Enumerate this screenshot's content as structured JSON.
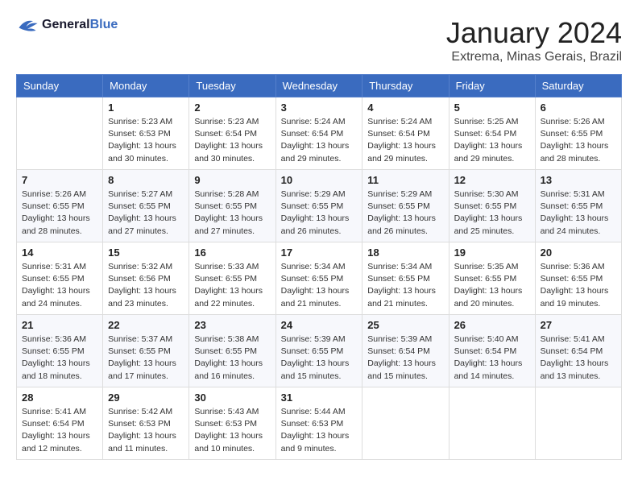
{
  "header": {
    "logo_line1": "General",
    "logo_line2": "Blue",
    "month_title": "January 2024",
    "location": "Extrema, Minas Gerais, Brazil"
  },
  "days_of_week": [
    "Sunday",
    "Monday",
    "Tuesday",
    "Wednesday",
    "Thursday",
    "Friday",
    "Saturday"
  ],
  "weeks": [
    [
      {
        "day": "",
        "info": ""
      },
      {
        "day": "1",
        "info": "Sunrise: 5:23 AM\nSunset: 6:53 PM\nDaylight: 13 hours\nand 30 minutes."
      },
      {
        "day": "2",
        "info": "Sunrise: 5:23 AM\nSunset: 6:54 PM\nDaylight: 13 hours\nand 30 minutes."
      },
      {
        "day": "3",
        "info": "Sunrise: 5:24 AM\nSunset: 6:54 PM\nDaylight: 13 hours\nand 29 minutes."
      },
      {
        "day": "4",
        "info": "Sunrise: 5:24 AM\nSunset: 6:54 PM\nDaylight: 13 hours\nand 29 minutes."
      },
      {
        "day": "5",
        "info": "Sunrise: 5:25 AM\nSunset: 6:54 PM\nDaylight: 13 hours\nand 29 minutes."
      },
      {
        "day": "6",
        "info": "Sunrise: 5:26 AM\nSunset: 6:55 PM\nDaylight: 13 hours\nand 28 minutes."
      }
    ],
    [
      {
        "day": "7",
        "info": "Sunrise: 5:26 AM\nSunset: 6:55 PM\nDaylight: 13 hours\nand 28 minutes."
      },
      {
        "day": "8",
        "info": "Sunrise: 5:27 AM\nSunset: 6:55 PM\nDaylight: 13 hours\nand 27 minutes."
      },
      {
        "day": "9",
        "info": "Sunrise: 5:28 AM\nSunset: 6:55 PM\nDaylight: 13 hours\nand 27 minutes."
      },
      {
        "day": "10",
        "info": "Sunrise: 5:29 AM\nSunset: 6:55 PM\nDaylight: 13 hours\nand 26 minutes."
      },
      {
        "day": "11",
        "info": "Sunrise: 5:29 AM\nSunset: 6:55 PM\nDaylight: 13 hours\nand 26 minutes."
      },
      {
        "day": "12",
        "info": "Sunrise: 5:30 AM\nSunset: 6:55 PM\nDaylight: 13 hours\nand 25 minutes."
      },
      {
        "day": "13",
        "info": "Sunrise: 5:31 AM\nSunset: 6:55 PM\nDaylight: 13 hours\nand 24 minutes."
      }
    ],
    [
      {
        "day": "14",
        "info": "Sunrise: 5:31 AM\nSunset: 6:55 PM\nDaylight: 13 hours\nand 24 minutes."
      },
      {
        "day": "15",
        "info": "Sunrise: 5:32 AM\nSunset: 6:56 PM\nDaylight: 13 hours\nand 23 minutes."
      },
      {
        "day": "16",
        "info": "Sunrise: 5:33 AM\nSunset: 6:55 PM\nDaylight: 13 hours\nand 22 minutes."
      },
      {
        "day": "17",
        "info": "Sunrise: 5:34 AM\nSunset: 6:55 PM\nDaylight: 13 hours\nand 21 minutes."
      },
      {
        "day": "18",
        "info": "Sunrise: 5:34 AM\nSunset: 6:55 PM\nDaylight: 13 hours\nand 21 minutes."
      },
      {
        "day": "19",
        "info": "Sunrise: 5:35 AM\nSunset: 6:55 PM\nDaylight: 13 hours\nand 20 minutes."
      },
      {
        "day": "20",
        "info": "Sunrise: 5:36 AM\nSunset: 6:55 PM\nDaylight: 13 hours\nand 19 minutes."
      }
    ],
    [
      {
        "day": "21",
        "info": "Sunrise: 5:36 AM\nSunset: 6:55 PM\nDaylight: 13 hours\nand 18 minutes."
      },
      {
        "day": "22",
        "info": "Sunrise: 5:37 AM\nSunset: 6:55 PM\nDaylight: 13 hours\nand 17 minutes."
      },
      {
        "day": "23",
        "info": "Sunrise: 5:38 AM\nSunset: 6:55 PM\nDaylight: 13 hours\nand 16 minutes."
      },
      {
        "day": "24",
        "info": "Sunrise: 5:39 AM\nSunset: 6:55 PM\nDaylight: 13 hours\nand 15 minutes."
      },
      {
        "day": "25",
        "info": "Sunrise: 5:39 AM\nSunset: 6:54 PM\nDaylight: 13 hours\nand 15 minutes."
      },
      {
        "day": "26",
        "info": "Sunrise: 5:40 AM\nSunset: 6:54 PM\nDaylight: 13 hours\nand 14 minutes."
      },
      {
        "day": "27",
        "info": "Sunrise: 5:41 AM\nSunset: 6:54 PM\nDaylight: 13 hours\nand 13 minutes."
      }
    ],
    [
      {
        "day": "28",
        "info": "Sunrise: 5:41 AM\nSunset: 6:54 PM\nDaylight: 13 hours\nand 12 minutes."
      },
      {
        "day": "29",
        "info": "Sunrise: 5:42 AM\nSunset: 6:53 PM\nDaylight: 13 hours\nand 11 minutes."
      },
      {
        "day": "30",
        "info": "Sunrise: 5:43 AM\nSunset: 6:53 PM\nDaylight: 13 hours\nand 10 minutes."
      },
      {
        "day": "31",
        "info": "Sunrise: 5:44 AM\nSunset: 6:53 PM\nDaylight: 13 hours\nand 9 minutes."
      },
      {
        "day": "",
        "info": ""
      },
      {
        "day": "",
        "info": ""
      },
      {
        "day": "",
        "info": ""
      }
    ]
  ]
}
